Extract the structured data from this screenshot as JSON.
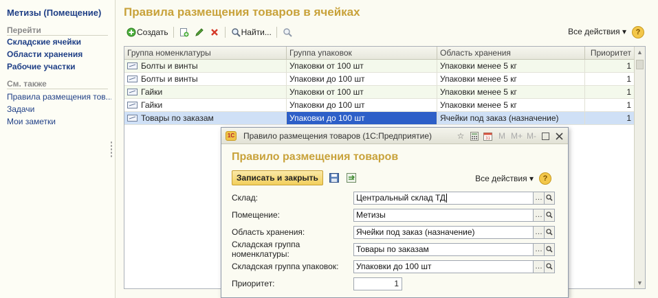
{
  "left_panel": {
    "title": "Метизы (Помещение)",
    "goto_header": "Перейти",
    "goto_links": [
      "Складские ячейки",
      "Области хранения",
      "Рабочие участки"
    ],
    "seealso_header": "См. также",
    "seealso_links": [
      "Правила размещения тов...",
      "Задачи",
      "Мои заметки"
    ]
  },
  "main": {
    "title": "Правила размещения товаров в ячейках",
    "toolbar": {
      "create_label": "Создать",
      "find_label": "Найти...",
      "all_actions": "Все действия"
    },
    "table": {
      "columns": [
        "Группа номенклатуры",
        "Группа упаковок",
        "Область хранения",
        "Приоритет"
      ],
      "rows": [
        [
          "Болты и винты",
          "Упаковки от 100 шт",
          "Упаковки менее 5 кг",
          "1"
        ],
        [
          "Болты и винты",
          "Упаковки до 100 шт",
          "Упаковки менее 5 кг",
          "1"
        ],
        [
          "Гайки",
          "Упаковки от 100 шт",
          "Упаковки менее 5 кг",
          "1"
        ],
        [
          "Гайки",
          "Упаковки до 100 шт",
          "Упаковки менее 5 кг",
          "1"
        ],
        [
          "Товары по заказам",
          "Упаковки до 100 шт",
          "Ячейки под заказ (назначение)",
          "1"
        ]
      ],
      "selected_row": 4
    }
  },
  "dialog": {
    "window_title": "Правило размещения товаров  (1С:Предприятие)",
    "logo_text": "1С",
    "title": "Правило размещения товаров",
    "save_close_label": "Записать и закрыть",
    "all_actions": "Все действия",
    "window_controls": [
      "M",
      "M+",
      "M-"
    ],
    "fields": [
      {
        "label": "Склад:",
        "value": "Центральный склад ТД"
      },
      {
        "label": "Помещение:",
        "value": "Метизы"
      },
      {
        "label": "Область хранения:",
        "value": "Ячейки под заказ (назначение)"
      },
      {
        "label": "Складская группа номенклатуры:",
        "value": "Товары по заказам"
      },
      {
        "label": "Складская группа упаковок:",
        "value": "Упаковки до 100 шт"
      }
    ],
    "priority_label": "Приоритет:",
    "priority_value": "1"
  },
  "colors": {
    "accent_title": "#c8a23a",
    "link": "#1f3f86",
    "selection": "#2d5fc8",
    "row_alt": "#f4f9ec"
  }
}
